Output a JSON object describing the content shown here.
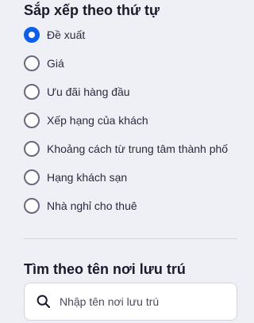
{
  "sort": {
    "title": "Sắp xếp theo thứ tự",
    "options": [
      {
        "label": "Đề xuất",
        "selected": true
      },
      {
        "label": "Giá",
        "selected": false
      },
      {
        "label": "Ưu đãi hàng đầu",
        "selected": false
      },
      {
        "label": "Xếp hạng của khách",
        "selected": false
      },
      {
        "label": "Khoảng cách từ trung tâm thành phố",
        "selected": false
      },
      {
        "label": "Hạng khách sạn",
        "selected": false
      },
      {
        "label": "Nhà nghỉ cho thuê",
        "selected": false
      }
    ]
  },
  "search": {
    "title": "Tìm theo tên nơi lưu trú",
    "placeholder": "Nhập tên nơi lưu trú",
    "value": "",
    "icon": "search-icon"
  },
  "colors": {
    "accent": "#0c5fe8",
    "radio_border": "#68697f",
    "background": "#eef0f5"
  }
}
